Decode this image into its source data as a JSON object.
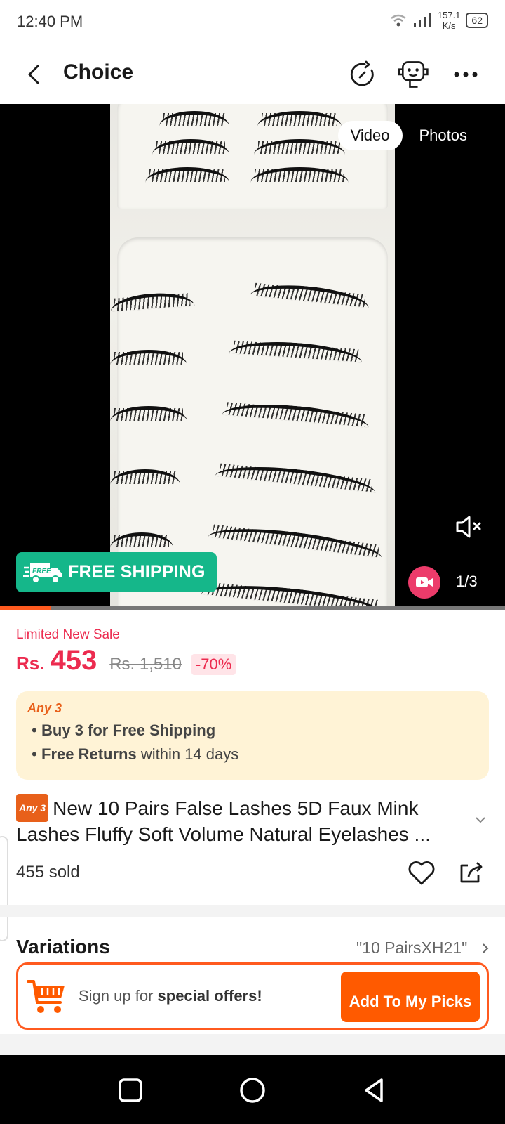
{
  "status": {
    "time": "12:40 PM",
    "net_speed_value": "157.1",
    "net_speed_unit": "K/s",
    "battery": "62"
  },
  "header": {
    "title": "Choice",
    "icons": [
      "back-icon",
      "history-icon",
      "support-bot-icon",
      "more-icon"
    ]
  },
  "media": {
    "tabs": [
      {
        "label": "Video",
        "active": true
      },
      {
        "label": "Photos",
        "active": false
      }
    ],
    "free_shipping_badge_text": "FREE",
    "free_shipping_label": "FREE SHIPPING",
    "counter": "1/3",
    "progress": 0.1,
    "colors": {
      "free_shipping": "#15b78a",
      "video_badge": "#ec3b6a",
      "progress": "#ff5a1f"
    }
  },
  "price": {
    "sale_label": "Limited New Sale",
    "currency": "Rs.",
    "current": "453",
    "original": "Rs. 1,510",
    "discount": "-70%",
    "color": "#ec2b4f"
  },
  "promo": {
    "tag": "Any 3",
    "line1_bold": "Buy 3 for  Free Shipping",
    "line2_bold": "Free Returns",
    "line2_rest": " within 14 days"
  },
  "product": {
    "badge": "Any 3",
    "title": "New 10 Pairs False Lashes 5D Faux Mink Lashes Fluffy Soft Volume Natural Eyelashes ...",
    "sold": "455 sold"
  },
  "variations": {
    "title": "Variations",
    "value": "\"10 PairsXH21\""
  },
  "signup": {
    "text_plain": "Sign up for ",
    "text_bold": "special offers!",
    "button_label": "Add To My Picks",
    "accent": "#ff5a00"
  },
  "navbar": {
    "buttons": [
      "recents-icon",
      "home-icon",
      "back-triangle-icon"
    ]
  }
}
